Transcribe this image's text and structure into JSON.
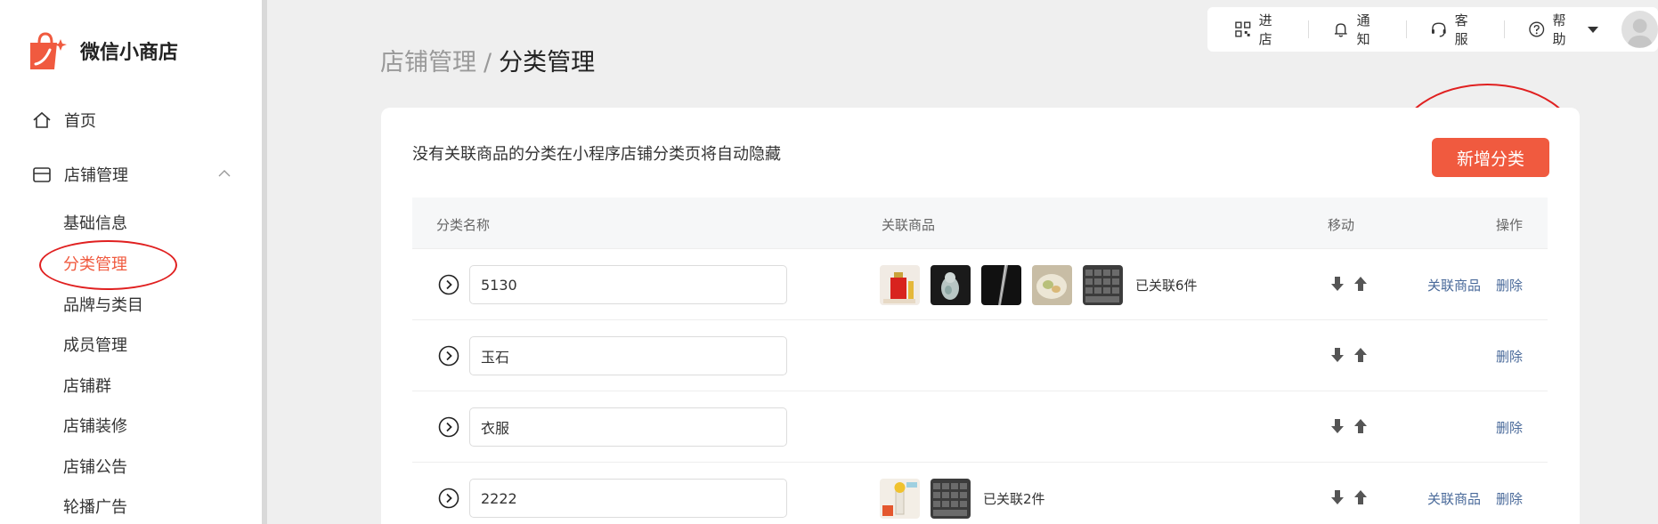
{
  "sidebar": {
    "brand": "微信小商店",
    "home": "首页",
    "store": "店铺管理",
    "sub_items": [
      "基础信息",
      "分类管理",
      "品牌与类目",
      "成员管理",
      "店铺群",
      "店铺装修",
      "店铺公告",
      "轮播广告"
    ]
  },
  "topbar": {
    "enter": "进店",
    "notify": "通知",
    "service": "客服",
    "help": "帮助"
  },
  "breadcrumb": {
    "parent": "店铺管理",
    "separator": "/",
    "current": "分类管理"
  },
  "card": {
    "tip": "没有关联商品的分类在小程序店铺分类页将自动隐藏",
    "add_button": "新增分类"
  },
  "table": {
    "headers": [
      "分类名称",
      "关联商品",
      "移动",
      "操作"
    ],
    "rows": [
      {
        "name": "5130",
        "linked_text": "已关联6件",
        "link_label": "关联商品",
        "delete_label": "删除"
      },
      {
        "name": "玉石",
        "linked_text": "",
        "link_label": "",
        "delete_label": "删除"
      },
      {
        "name": "衣服",
        "linked_text": "",
        "link_label": "",
        "delete_label": "删除"
      },
      {
        "name": "2222",
        "linked_text": "已关联2件",
        "link_label": "关联商品",
        "delete_label": "删除"
      }
    ]
  },
  "colors": {
    "accent": "#f05a3f",
    "link": "#4a6a9a",
    "annotation": "#e02020"
  }
}
